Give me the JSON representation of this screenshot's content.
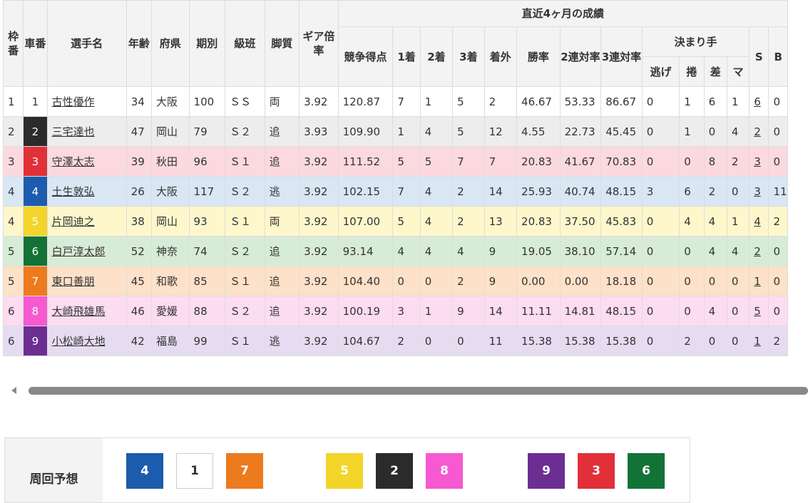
{
  "headers": {
    "waku": "枠番",
    "sha": "車番",
    "name": "選手名",
    "age": "年齢",
    "pref": "府県",
    "term": "期別",
    "class": "級班",
    "leg": "脚質",
    "gear": "ギア倍率",
    "recent": "直近4ヶ月の成績",
    "score": "競争得点",
    "first": "1着",
    "second": "2着",
    "third": "3着",
    "out": "着外",
    "win_rate": "勝率",
    "quinella_rate": "2連対率",
    "trio_rate": "3連対率",
    "kimarite": "決まり手",
    "nige": "逃げ",
    "makuri": "捲",
    "sashi": "差",
    "mark": "マ",
    "s": "S",
    "b": "B"
  },
  "colors": {
    "car1": "#ffffff",
    "car2": "#2b2b2b",
    "car3": "#e23039",
    "car4": "#1d5bae",
    "car5": "#f3d52a",
    "car6": "#137336",
    "car7": "#ee7a1e",
    "car8": "#f659d0",
    "car9": "#6c2e93"
  },
  "rows": [
    {
      "waku": "1",
      "sha": "1",
      "name": "古性優作",
      "age": "34",
      "pref": "大阪",
      "term": "100",
      "class": "ＳＳ",
      "leg": "両",
      "gear": "3.92",
      "score": "120.87",
      "c1": "7",
      "c2": "1",
      "c3": "5",
      "out": "2",
      "win": "46.67",
      "q": "53.33",
      "t": "86.67",
      "k1": "0",
      "k2": "1",
      "k3": "6",
      "k4": "1",
      "s": "6",
      "b": "0"
    },
    {
      "waku": "2",
      "sha": "2",
      "name": "三宅達也",
      "age": "47",
      "pref": "岡山",
      "term": "79",
      "class": "Ｓ２",
      "leg": "追",
      "gear": "3.93",
      "score": "109.90",
      "c1": "1",
      "c2": "4",
      "c3": "5",
      "out": "12",
      "win": "4.55",
      "q": "22.73",
      "t": "45.45",
      "k1": "0",
      "k2": "1",
      "k3": "0",
      "k4": "4",
      "s": "2",
      "b": "0"
    },
    {
      "waku": "3",
      "sha": "3",
      "name": "守澤太志",
      "age": "39",
      "pref": "秋田",
      "term": "96",
      "class": "Ｓ１",
      "leg": "追",
      "gear": "3.92",
      "score": "111.52",
      "c1": "5",
      "c2": "5",
      "c3": "7",
      "out": "7",
      "win": "20.83",
      "q": "41.67",
      "t": "70.83",
      "k1": "0",
      "k2": "0",
      "k3": "8",
      "k4": "2",
      "s": "3",
      "b": "0"
    },
    {
      "waku": "4",
      "sha": "4",
      "name": "土生敦弘",
      "age": "26",
      "pref": "大阪",
      "term": "117",
      "class": "Ｓ２",
      "leg": "逃",
      "gear": "3.92",
      "score": "102.15",
      "c1": "7",
      "c2": "4",
      "c3": "2",
      "out": "14",
      "win": "25.93",
      "q": "40.74",
      "t": "48.15",
      "k1": "3",
      "k2": "6",
      "k3": "2",
      "k4": "0",
      "s": "3",
      "b": "11"
    },
    {
      "waku": "4",
      "sha": "5",
      "name": "片岡迪之",
      "age": "38",
      "pref": "岡山",
      "term": "93",
      "class": "Ｓ１",
      "leg": "両",
      "gear": "3.92",
      "score": "107.00",
      "c1": "5",
      "c2": "4",
      "c3": "2",
      "out": "13",
      "win": "20.83",
      "q": "37.50",
      "t": "45.83",
      "k1": "0",
      "k2": "4",
      "k3": "4",
      "k4": "1",
      "s": "4",
      "b": "2"
    },
    {
      "waku": "5",
      "sha": "6",
      "name": "白戸淳太郎",
      "age": "52",
      "pref": "神奈",
      "term": "74",
      "class": "Ｓ２",
      "leg": "追",
      "gear": "3.92",
      "score": "93.14",
      "c1": "4",
      "c2": "4",
      "c3": "4",
      "out": "9",
      "win": "19.05",
      "q": "38.10",
      "t": "57.14",
      "k1": "0",
      "k2": "0",
      "k3": "4",
      "k4": "4",
      "s": "2",
      "b": "0"
    },
    {
      "waku": "5",
      "sha": "7",
      "name": "東口善朋",
      "age": "45",
      "pref": "和歌",
      "term": "85",
      "class": "Ｓ１",
      "leg": "追",
      "gear": "3.92",
      "score": "104.40",
      "c1": "0",
      "c2": "0",
      "c3": "2",
      "out": "9",
      "win": "0.00",
      "q": "0.00",
      "t": "18.18",
      "k1": "0",
      "k2": "0",
      "k3": "0",
      "k4": "0",
      "s": "1",
      "b": "0"
    },
    {
      "waku": "6",
      "sha": "8",
      "name": "大崎飛雄馬",
      "age": "46",
      "pref": "愛媛",
      "term": "88",
      "class": "Ｓ２",
      "leg": "追",
      "gear": "3.92",
      "score": "100.19",
      "c1": "3",
      "c2": "1",
      "c3": "9",
      "out": "14",
      "win": "11.11",
      "q": "14.81",
      "t": "48.15",
      "k1": "0",
      "k2": "0",
      "k3": "4",
      "k4": "0",
      "s": "5",
      "b": "0"
    },
    {
      "waku": "6",
      "sha": "9",
      "name": "小松崎大地",
      "age": "42",
      "pref": "福島",
      "term": "99",
      "class": "Ｓ１",
      "leg": "逃",
      "gear": "3.92",
      "score": "104.67",
      "c1": "2",
      "c2": "0",
      "c3": "0",
      "out": "11",
      "win": "15.38",
      "q": "15.38",
      "t": "15.38",
      "k1": "0",
      "k2": "2",
      "k3": "0",
      "k4": "0",
      "s": "1",
      "b": "2"
    }
  ],
  "yoso": {
    "label": "周回予想",
    "boxes": [
      "4",
      "1",
      "7",
      "5",
      "2",
      "8",
      "9",
      "3",
      "6"
    ]
  }
}
